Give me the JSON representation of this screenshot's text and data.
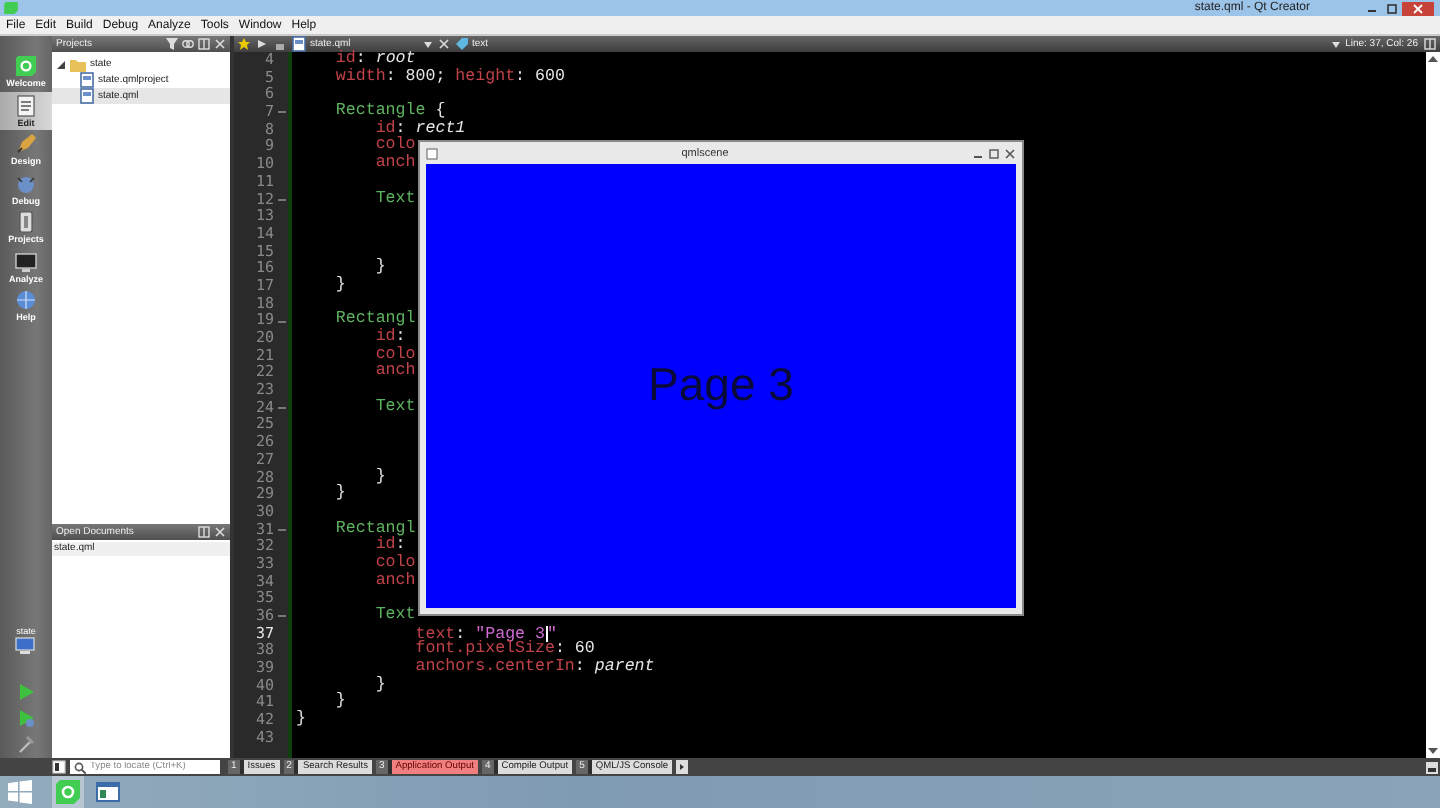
{
  "window": {
    "title": "state.qml - Qt Creator"
  },
  "menu": [
    "File",
    "Edit",
    "Build",
    "Debug",
    "Analyze",
    "Tools",
    "Window",
    "Help"
  ],
  "modes": [
    {
      "label": "Welcome",
      "selected": false
    },
    {
      "label": "Edit",
      "selected": true
    },
    {
      "label": "Design",
      "selected": false
    },
    {
      "label": "Debug",
      "selected": false
    },
    {
      "label": "Projects",
      "selected": false
    },
    {
      "label": "Analyze",
      "selected": false
    },
    {
      "label": "Help",
      "selected": false
    }
  ],
  "target": {
    "label": "state"
  },
  "projects_panel": {
    "title": "Projects",
    "tree": [
      {
        "label": "state",
        "expanded": true,
        "selected": false,
        "children": [
          {
            "label": "state.qmlproject",
            "selected": false
          },
          {
            "label": "state.qml",
            "selected": true
          }
        ]
      }
    ]
  },
  "open_documents": {
    "title": "Open Documents",
    "items": [
      "state.qml"
    ]
  },
  "editor": {
    "file": "state.qml",
    "symbol": "text",
    "position": "Line: 37, Col: 26",
    "lines": [
      {
        "number": "4",
        "current": false,
        "foldable": false,
        "tokens": [
          {
            "kind": "prop",
            "text": "    id"
          },
          {
            "kind": "plain",
            "text": ": "
          },
          {
            "kind": "value",
            "text": "root"
          }
        ]
      },
      {
        "number": "5",
        "current": false,
        "foldable": false,
        "tokens": [
          {
            "kind": "prop",
            "text": "    width"
          },
          {
            "kind": "plain",
            "text": ": 800; "
          },
          {
            "kind": "prop",
            "text": "height"
          },
          {
            "kind": "plain",
            "text": ": 600"
          }
        ]
      },
      {
        "number": "6",
        "current": false,
        "foldable": false
      },
      {
        "number": "7",
        "current": false,
        "foldable": true,
        "tokens": [
          {
            "kind": "type",
            "text": "    Rectangle"
          },
          {
            "kind": "plain",
            "text": " {"
          }
        ]
      },
      {
        "number": "8",
        "current": false,
        "foldable": false,
        "tokens": [
          {
            "kind": "prop",
            "text": "        id"
          },
          {
            "kind": "plain",
            "text": ": "
          },
          {
            "kind": "value",
            "text": "rect1"
          }
        ]
      },
      {
        "number": "9",
        "current": false,
        "foldable": false,
        "tokens": [
          {
            "kind": "prop",
            "text": "        colo"
          }
        ]
      },
      {
        "number": "10",
        "current": false,
        "foldable": false,
        "tokens": [
          {
            "kind": "prop",
            "text": "        anch"
          }
        ]
      },
      {
        "number": "11",
        "current": false,
        "foldable": false
      },
      {
        "number": "12",
        "current": false,
        "foldable": true,
        "tokens": [
          {
            "kind": "type",
            "text": "        Text"
          }
        ]
      },
      {
        "number": "13",
        "current": false,
        "foldable": false
      },
      {
        "number": "14",
        "current": false,
        "foldable": false
      },
      {
        "number": "15",
        "current": false,
        "foldable": false
      },
      {
        "number": "16",
        "current": false,
        "foldable": false,
        "tokens": [
          {
            "kind": "plain",
            "text": "        }"
          }
        ]
      },
      {
        "number": "17",
        "current": false,
        "foldable": false,
        "tokens": [
          {
            "kind": "plain",
            "text": "    }"
          }
        ]
      },
      {
        "number": "18",
        "current": false,
        "foldable": false
      },
      {
        "number": "19",
        "current": false,
        "foldable": true,
        "tokens": [
          {
            "kind": "type",
            "text": "    Rectangl"
          }
        ]
      },
      {
        "number": "20",
        "current": false,
        "foldable": false,
        "tokens": [
          {
            "kind": "prop",
            "text": "        id"
          },
          {
            "kind": "plain",
            "text": ":"
          }
        ]
      },
      {
        "number": "21",
        "current": false,
        "foldable": false,
        "tokens": [
          {
            "kind": "prop",
            "text": "        colo"
          }
        ]
      },
      {
        "number": "22",
        "current": false,
        "foldable": false,
        "tokens": [
          {
            "kind": "prop",
            "text": "        anch"
          }
        ]
      },
      {
        "number": "23",
        "current": false,
        "foldable": false
      },
      {
        "number": "24",
        "current": false,
        "foldable": true,
        "tokens": [
          {
            "kind": "type",
            "text": "        Text"
          }
        ]
      },
      {
        "number": "25",
        "current": false,
        "foldable": false
      },
      {
        "number": "26",
        "current": false,
        "foldable": false
      },
      {
        "number": "27",
        "current": false,
        "foldable": false
      },
      {
        "number": "28",
        "current": false,
        "foldable": false,
        "tokens": [
          {
            "kind": "plain",
            "text": "        }"
          }
        ]
      },
      {
        "number": "29",
        "current": false,
        "foldable": false,
        "tokens": [
          {
            "kind": "plain",
            "text": "    }"
          }
        ]
      },
      {
        "number": "30",
        "current": false,
        "foldable": false
      },
      {
        "number": "31",
        "current": false,
        "foldable": true,
        "tokens": [
          {
            "kind": "type",
            "text": "    Rectangl"
          }
        ]
      },
      {
        "number": "32",
        "current": false,
        "foldable": false,
        "tokens": [
          {
            "kind": "prop",
            "text": "        id"
          },
          {
            "kind": "plain",
            "text": ":"
          }
        ]
      },
      {
        "number": "33",
        "current": false,
        "foldable": false,
        "tokens": [
          {
            "kind": "prop",
            "text": "        colo"
          }
        ]
      },
      {
        "number": "34",
        "current": false,
        "foldable": false,
        "tokens": [
          {
            "kind": "prop",
            "text": "        anch"
          }
        ]
      },
      {
        "number": "35",
        "current": false,
        "foldable": false
      },
      {
        "number": "36",
        "current": false,
        "foldable": true,
        "tokens": [
          {
            "kind": "type",
            "text": "        Text"
          }
        ]
      },
      {
        "number": "37",
        "current": true,
        "foldable": false,
        "tokens": [
          {
            "kind": "prop",
            "text": "            text"
          },
          {
            "kind": "plain",
            "text": ": "
          },
          {
            "kind": "string",
            "text": "\"Page 3"
          },
          {
            "kind": "cursor"
          },
          {
            "kind": "string",
            "text": "\""
          }
        ]
      },
      {
        "number": "38",
        "current": false,
        "foldable": false,
        "tokens": [
          {
            "kind": "prop",
            "text": "            font.pixelSize"
          },
          {
            "kind": "plain",
            "text": ": 60"
          }
        ]
      },
      {
        "number": "39",
        "current": false,
        "foldable": false,
        "tokens": [
          {
            "kind": "prop",
            "text": "            anchors.centerIn"
          },
          {
            "kind": "plain",
            "text": ": "
          },
          {
            "kind": "value",
            "text": "parent"
          }
        ]
      },
      {
        "number": "40",
        "current": false,
        "foldable": false,
        "tokens": [
          {
            "kind": "plain",
            "text": "        }"
          }
        ]
      },
      {
        "number": "41",
        "current": false,
        "foldable": false,
        "tokens": [
          {
            "kind": "plain",
            "text": "    }"
          }
        ]
      },
      {
        "number": "42",
        "current": false,
        "foldable": false,
        "tokens": [
          {
            "kind": "plain",
            "text": "}"
          }
        ]
      },
      {
        "number": "43",
        "current": false,
        "foldable": false
      }
    ]
  },
  "scene_window": {
    "title": "qmlscene",
    "text": "Page 3"
  },
  "locator": {
    "placeholder": "Type to locate (Ctrl+K)"
  },
  "output_tabs": [
    {
      "number": "1",
      "label": "Issues",
      "alert": false
    },
    {
      "number": "2",
      "label": "Search Results",
      "alert": false
    },
    {
      "number": "3",
      "label": "Application Output",
      "alert": true
    },
    {
      "number": "4",
      "label": "Compile Output",
      "alert": false
    },
    {
      "number": "5",
      "label": "QML/JS Console",
      "alert": false
    }
  ],
  "taskbar": {
    "apps": [
      {
        "kind": "qt",
        "selected": true
      },
      {
        "kind": "window",
        "selected": false
      }
    ]
  }
}
